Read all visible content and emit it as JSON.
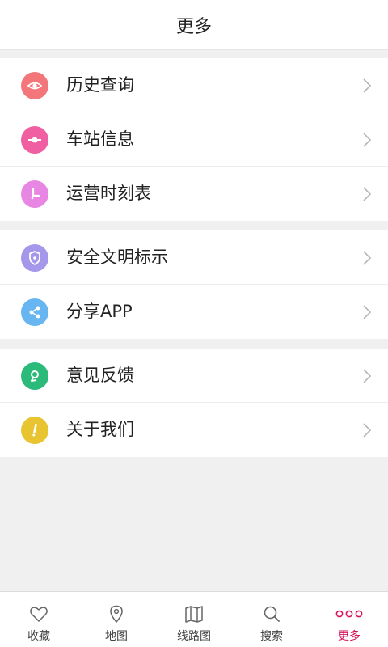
{
  "header": {
    "title": "更多"
  },
  "groups": [
    [
      {
        "label": "历史查询",
        "icon": "eye-icon",
        "color": "#f2767a"
      },
      {
        "label": "车站信息",
        "icon": "station-icon",
        "color": "#ef5fa1"
      },
      {
        "label": "运营时刻表",
        "icon": "clock-icon",
        "color": "#e887e3"
      }
    ],
    [
      {
        "label": "安全文明标示",
        "icon": "shield-icon",
        "color": "#a597ea"
      },
      {
        "label": "分享APP",
        "icon": "share-icon",
        "color": "#67b6f2"
      }
    ],
    [
      {
        "label": "意见反馈",
        "icon": "feedback-icon",
        "color": "#2bba79"
      },
      {
        "label": "关于我们",
        "icon": "exclamation-icon",
        "color": "#e9c431"
      }
    ]
  ],
  "tabs": [
    {
      "label": "收藏",
      "icon": "heart-icon"
    },
    {
      "label": "地图",
      "icon": "map-pin-icon"
    },
    {
      "label": "线路图",
      "icon": "route-map-icon"
    },
    {
      "label": "搜索",
      "icon": "search-icon"
    },
    {
      "label": "更多",
      "icon": "more-dots-icon",
      "active": true
    }
  ],
  "colors": {
    "accent": "#d6155b",
    "background": "#f0f0f0"
  }
}
